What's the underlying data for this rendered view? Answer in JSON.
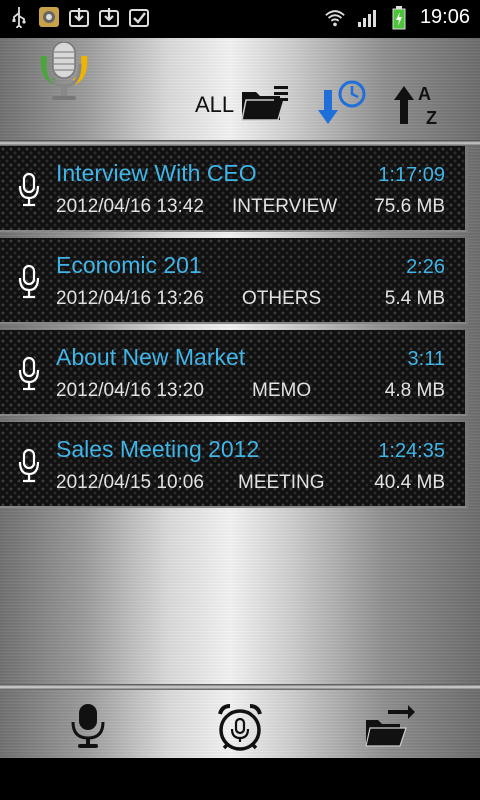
{
  "status_bar": {
    "time": "19:06",
    "left_icons": [
      "usb-icon",
      "app-notification-icon",
      "download-icon",
      "download-done-icon",
      "task-done-icon"
    ],
    "right_icons": [
      "wifi-icon",
      "signal-icon",
      "battery-charging-icon"
    ]
  },
  "toolbar": {
    "filter_label": "ALL",
    "icons": [
      "app-logo-mic-icon",
      "folder-list-icon",
      "sort-by-time-icon",
      "sort-az-icon"
    ]
  },
  "recordings": [
    {
      "title": "Interview With CEO",
      "duration": "1:17:09",
      "date": "2012/04/16 13:42",
      "category": "INTERVIEW",
      "size": "75.6 MB"
    },
    {
      "title": "Economic 201",
      "duration": "2:26",
      "date": "2012/04/16 13:26",
      "category": "OTHERS",
      "size": "5.4 MB"
    },
    {
      "title": "About New Market",
      "duration": "3:11",
      "date": "2012/04/16 13:20",
      "category": "MEMO",
      "size": "4.8 MB"
    },
    {
      "title": "Sales Meeting 2012",
      "duration": "1:24:35",
      "date": "2012/04/15 10:06",
      "category": "MEETING",
      "size": "40.4 MB"
    }
  ],
  "bottom_bar": {
    "icons": [
      "record-mic-icon",
      "alarm-record-icon",
      "folder-transfer-icon"
    ]
  },
  "colors": {
    "title_accent": "#3fb5e8",
    "meta_text": "#e2e2e2",
    "list_background": "#111111"
  }
}
